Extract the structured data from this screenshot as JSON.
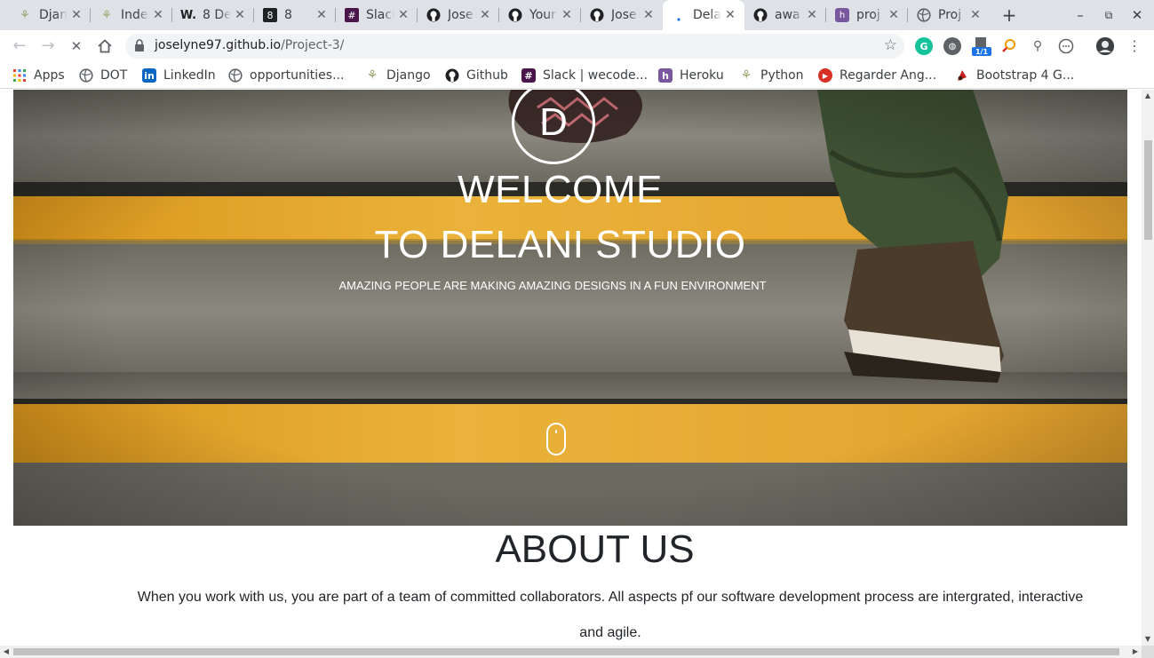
{
  "tabs": [
    {
      "title": "Django",
      "icon": "django-icon",
      "color": "#9aa26e"
    },
    {
      "title": "Index",
      "icon": "django-icon",
      "color": "#9aa26e"
    },
    {
      "title": "8 De",
      "icon": "w-icon",
      "color": "#202124"
    },
    {
      "title": "8",
      "icon": "number-icon",
      "color": "#202124"
    },
    {
      "title": "Slack",
      "icon": "slack-icon",
      "color": "#4a154b"
    },
    {
      "title": "Jose",
      "icon": "github-icon",
      "color": "#202124"
    },
    {
      "title": "Your",
      "icon": "github-icon",
      "color": "#202124"
    },
    {
      "title": "Jose",
      "icon": "github-icon",
      "color": "#202124"
    },
    {
      "title": "Dela",
      "icon": "loading-icon",
      "color": "#1a73e8",
      "active": true
    },
    {
      "title": "awa",
      "icon": "github-icon",
      "color": "#202124"
    },
    {
      "title": "proj",
      "icon": "heroku-icon",
      "color": "#79589f"
    },
    {
      "title": "Proj",
      "icon": "globe-icon",
      "color": "#5f6368"
    }
  ],
  "address_bar": {
    "domain": "joselyne97.github.io",
    "path": "/Project-3/"
  },
  "bookmarks": [
    {
      "label": "Apps",
      "icon": "apps-grid-icon"
    },
    {
      "label": "DOT",
      "icon": "globe-icon"
    },
    {
      "label": "LinkedIn",
      "icon": "linkedin-icon"
    },
    {
      "label": "opportunities...",
      "icon": "globe-icon"
    },
    {
      "label": "Django",
      "icon": "django-icon"
    },
    {
      "label": "Github",
      "icon": "github-icon"
    },
    {
      "label": "Slack | wecode...",
      "icon": "slack-icon"
    },
    {
      "label": "Heroku",
      "icon": "heroku-icon"
    },
    {
      "label": "Python",
      "icon": "django-icon"
    },
    {
      "label": "Regarder Ang...",
      "icon": "play-icon"
    },
    {
      "label": "Bootstrap 4 G...",
      "icon": "bootstrap-icon"
    }
  ],
  "extensions": {
    "badge_count": "1/1"
  },
  "hero": {
    "logo_letter": "D",
    "heading_line1": "WELCOME",
    "heading_line2": "TO DELANI STUDIO",
    "tagline": "AMAZING PEOPLE ARE MAKING AMAZING DESIGNS IN A FUN ENVIRONMENT"
  },
  "about": {
    "title": "ABOUT US",
    "text": "When you work with us, you are part of a team of committed collaborators. All aspects pf our software development process are intergrated, interactive and agile."
  },
  "colors": {
    "hero_yellow": "#e7a827",
    "hero_concrete": "#807e74",
    "text_dark": "#212529"
  }
}
